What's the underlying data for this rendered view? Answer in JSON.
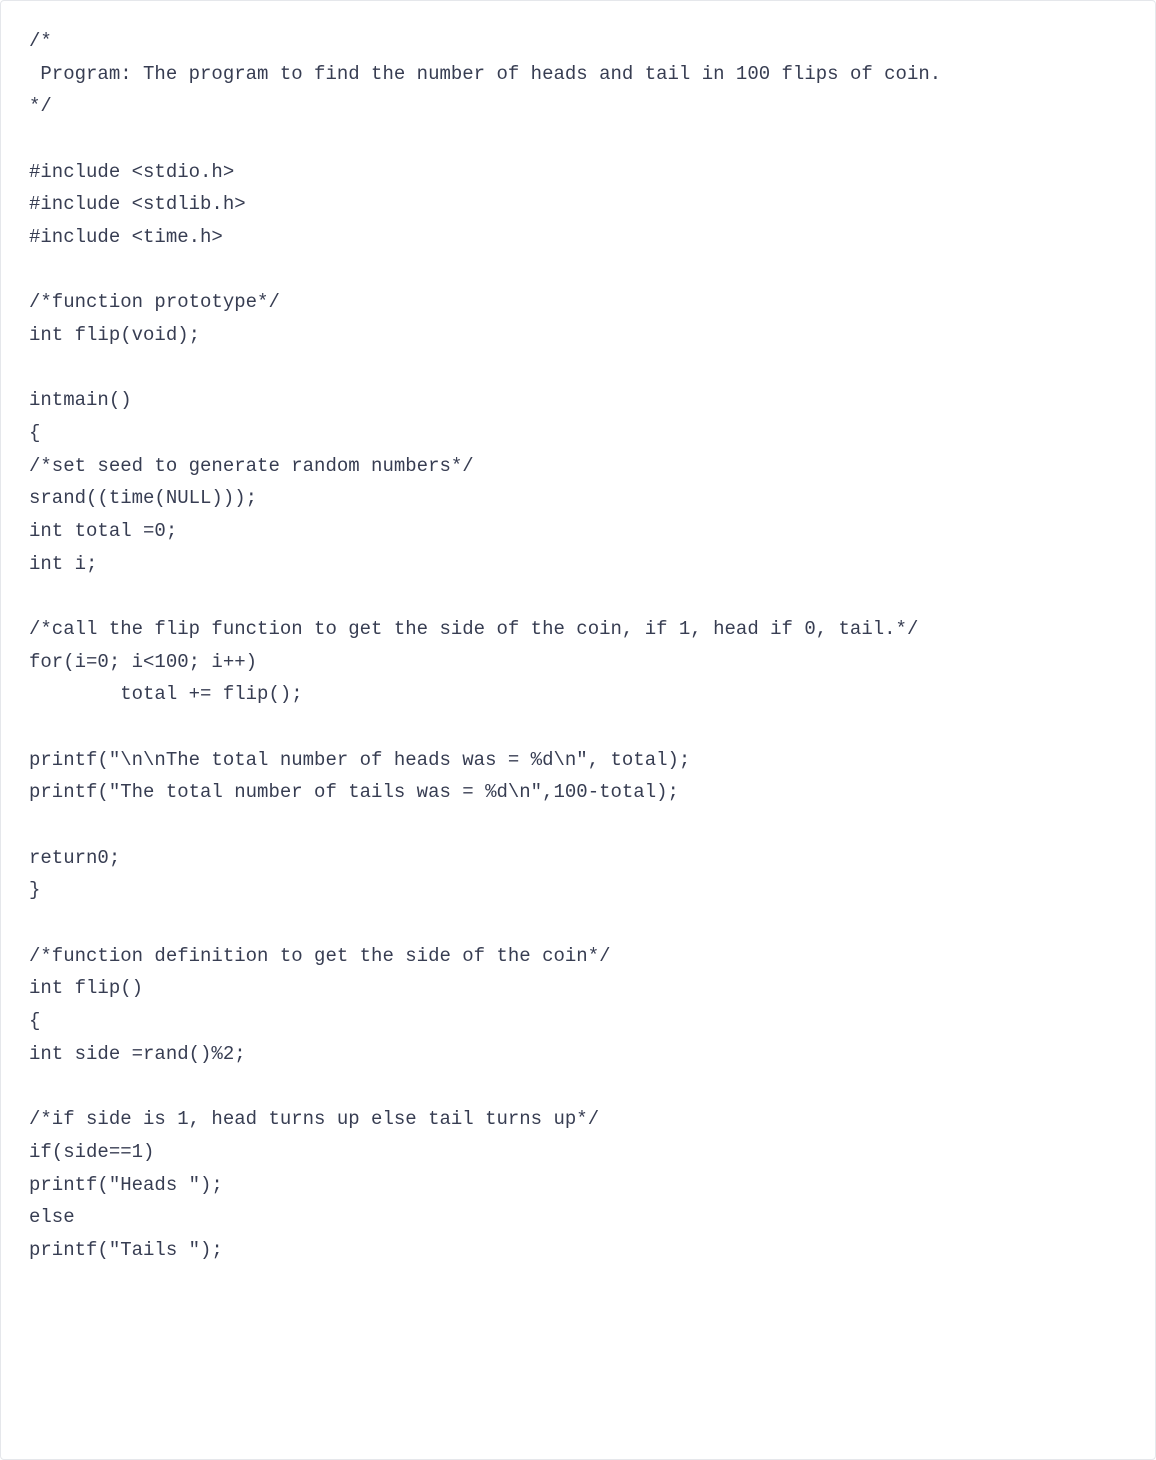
{
  "code": {
    "lines": [
      "/*",
      " Program: The program to find the number of heads and tail in 100 flips of coin.",
      "*/",
      "",
      "#include <stdio.h>",
      "#include <stdlib.h>",
      "#include <time.h>",
      "",
      "/*function prototype*/",
      "int flip(void);",
      "",
      "intmain()",
      "{",
      "/*set seed to generate random numbers*/",
      "srand((time(NULL)));",
      "int total =0;",
      "int i;",
      "",
      "/*call the flip function to get the side of the coin, if 1, head if 0, tail.*/",
      "for(i=0; i<100; i++)",
      "        total += flip();",
      "",
      "printf(\"\\n\\nThe total number of heads was = %d\\n\", total);",
      "printf(\"The total number of tails was = %d\\n\",100-total);",
      "",
      "return0;",
      "}",
      "",
      "/*function definition to get the side of the coin*/",
      "int flip()",
      "{",
      "int side =rand()%2;",
      "",
      "/*if side is 1, head turns up else tail turns up*/",
      "if(side==1)",
      "printf(\"Heads \");",
      "else",
      "printf(\"Tails \");"
    ]
  }
}
